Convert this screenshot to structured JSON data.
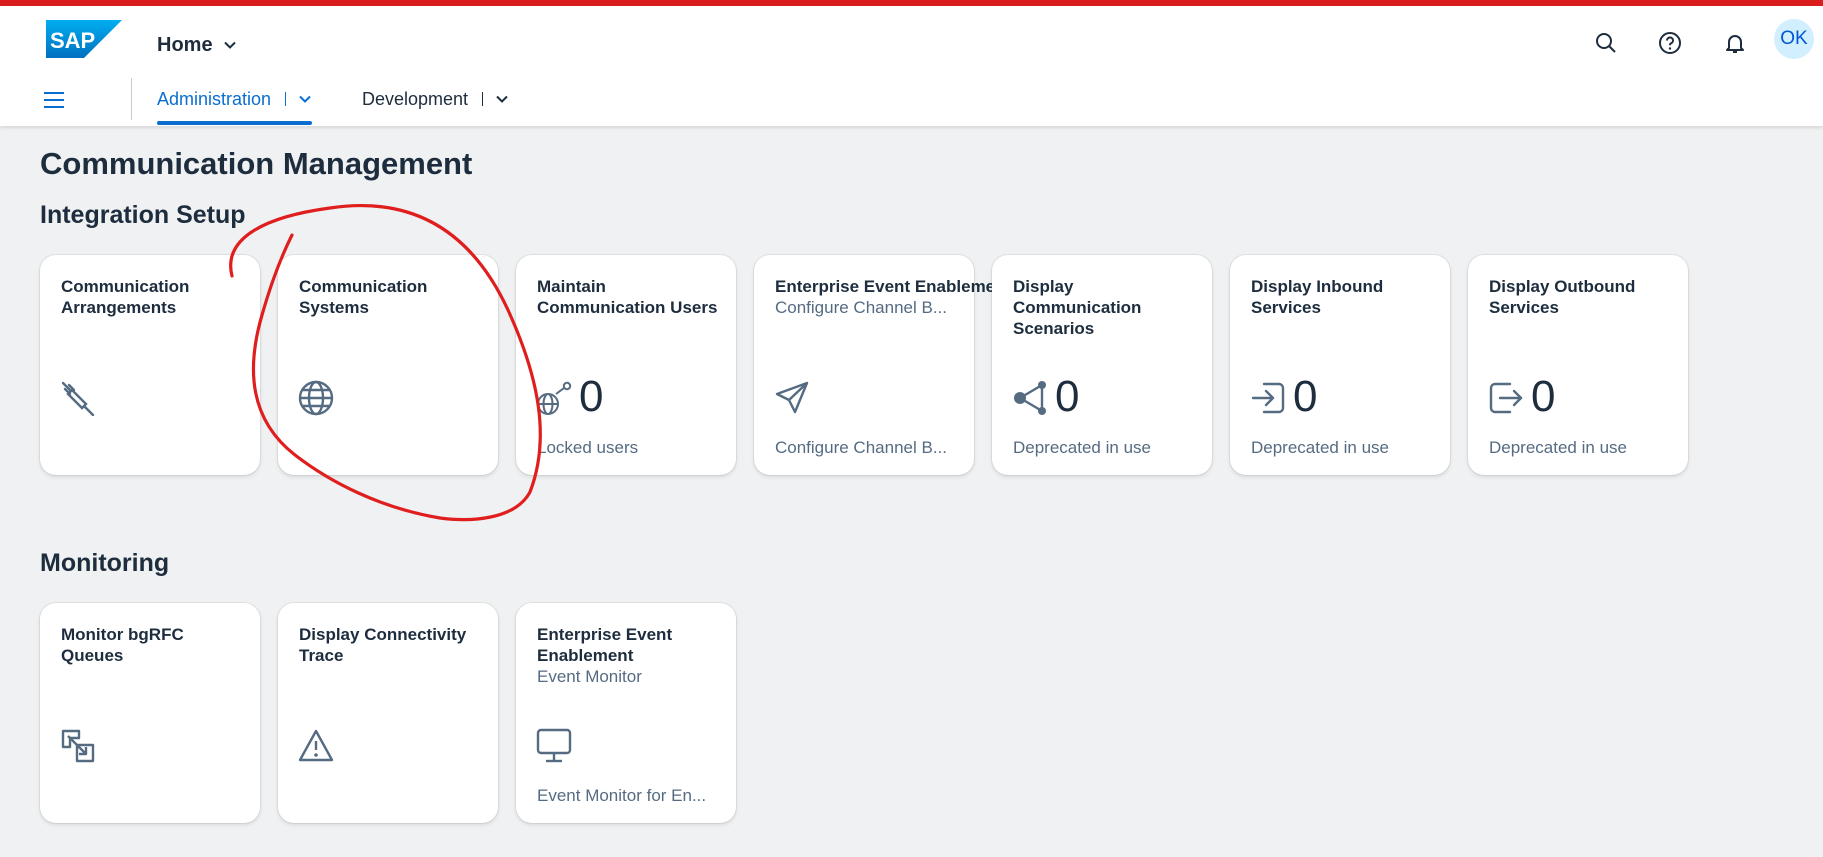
{
  "shell": {
    "home_label": "Home",
    "avatar_initials": "OK",
    "brand_logo_text": "SAP",
    "accent_color": "#d91c1c",
    "icons": [
      "search-icon",
      "help-icon",
      "notification-bell-icon"
    ]
  },
  "nav": {
    "tabs": [
      {
        "label": "Administration",
        "active": true
      },
      {
        "label": "Development",
        "active": false
      }
    ]
  },
  "page": {
    "title": "Communication Management"
  },
  "sections": [
    {
      "title": "Integration Setup",
      "tiles": [
        {
          "title": "Communication Arrangements",
          "subtitle": "",
          "icon": "plug-icon",
          "number": "",
          "footer": ""
        },
        {
          "title": "Communication Systems",
          "subtitle": "",
          "icon": "globe-icon",
          "number": "",
          "footer": ""
        },
        {
          "title": "Maintain Communication Users",
          "subtitle": "",
          "icon": "globe-key-icon",
          "number": "0",
          "footer": "Locked users"
        },
        {
          "title": "Enterprise Event Enablement",
          "subtitle": "Configure Channel B...",
          "icon": "paper-plane-icon",
          "number": "",
          "footer": "Configure Channel B..."
        },
        {
          "title": "Display Communication Scenarios",
          "subtitle": "",
          "icon": "share-icon",
          "number": "0",
          "footer": "Deprecated in use"
        },
        {
          "title": "Display Inbound Services",
          "subtitle": "",
          "icon": "inbound-arrow-icon",
          "number": "0",
          "footer": "Deprecated in use"
        },
        {
          "title": "Display Outbound Services",
          "subtitle": "",
          "icon": "outbound-arrow-icon",
          "number": "0",
          "footer": "Deprecated in use"
        }
      ]
    },
    {
      "title": "Monitoring",
      "tiles": [
        {
          "title": "Monitor bgRFC Queues",
          "subtitle": "",
          "icon": "queue-transfer-icon",
          "number": "",
          "footer": ""
        },
        {
          "title": "Display Connectivity Trace",
          "subtitle": "",
          "icon": "warning-icon",
          "number": "",
          "footer": ""
        },
        {
          "title": "Enterprise Event Enablement",
          "subtitle": "Event Monitor",
          "icon": "monitor-icon",
          "number": "",
          "footer": "Event Monitor for En..."
        }
      ]
    }
  ]
}
